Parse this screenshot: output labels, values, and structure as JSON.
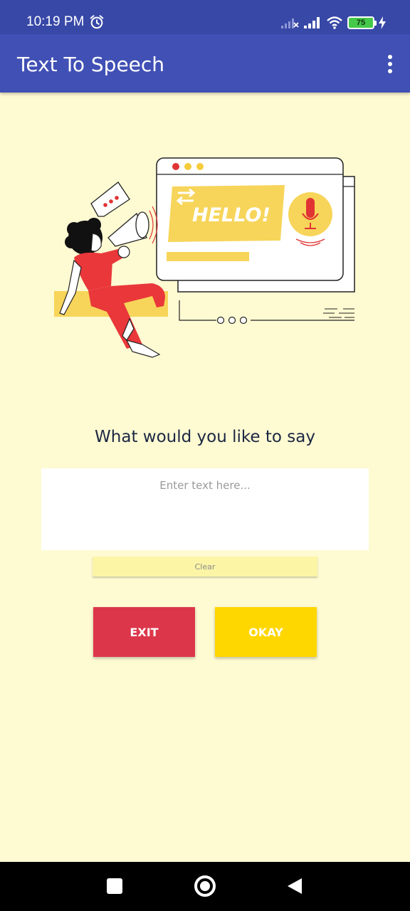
{
  "status_bar": {
    "time": "10:19 PM",
    "battery_level": "75",
    "icons": [
      "alarm-icon",
      "signal-no-service-icon",
      "signal-icon",
      "wifi-icon",
      "battery-icon",
      "charging-icon"
    ]
  },
  "app_bar": {
    "title": "Text To Speech",
    "menu_icon": "more-vert-icon"
  },
  "illustration": {
    "greeting_text": "HELLO!"
  },
  "main": {
    "prompt": "What would you like to say",
    "input_placeholder": "Enter text here...",
    "input_value": "",
    "clear_label": "Clear",
    "exit_label": "EXIT",
    "okay_label": "OKAY"
  },
  "nav_bar": {
    "icons": [
      "recents-icon",
      "home-icon",
      "back-icon"
    ]
  },
  "colors": {
    "app_bar": "#4050B5",
    "status_bar": "#3848A7",
    "background": "#FEFAD2",
    "exit": "#DC364A",
    "okay": "#FFD700",
    "clear": "#FCF5A6",
    "prompt_text": "#1B2743"
  }
}
